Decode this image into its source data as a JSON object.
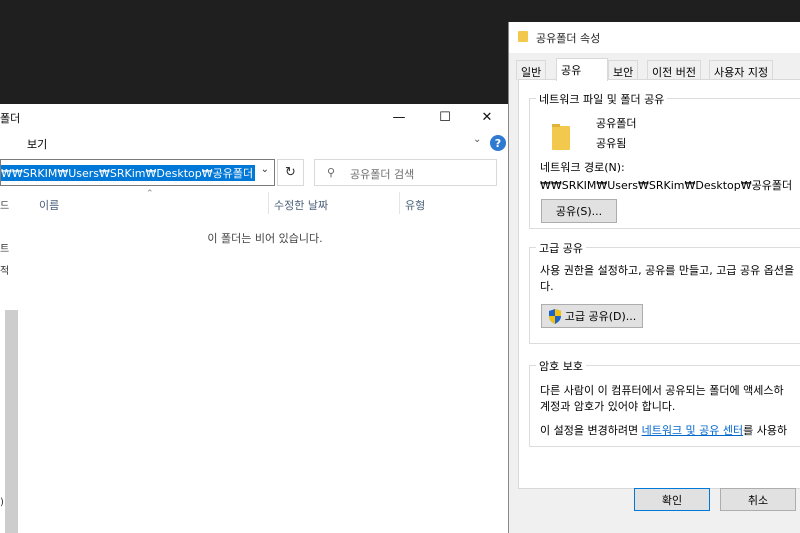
{
  "explorer": {
    "title": "폴더",
    "ribbon_view": "보기",
    "controls": {
      "minimize": "—",
      "maximize": "☐",
      "close": "✕"
    },
    "address": "₩₩SRKIM₩Users₩SRKim₩Desktop₩공유폴더",
    "search_placeholder": "공유폴더 검색",
    "columns": {
      "name": "이름",
      "modified": "수정한 날짜",
      "type": "유형"
    },
    "empty_message": "이 폴더는 비어 있습니다.",
    "nav_fragments": [
      "드",
      "트",
      "적",
      ")"
    ]
  },
  "properties": {
    "title": "공유폴더 속성",
    "tabs": [
      "일반",
      "공유",
      "보안",
      "이전 버전",
      "사용자 지정"
    ],
    "active_tab": "공유",
    "network_share": {
      "group_label": "네트워크 파일 및 폴더 공유",
      "folder_name": "공유폴더",
      "status": "공유됨",
      "path_label": "네트워크 경로(N):",
      "path_value": "₩₩SRKIM₩Users₩SRKim₩Desktop₩공유폴더",
      "share_button": "공유(S)..."
    },
    "advanced_share": {
      "group_label": "고급 공유",
      "description_line1": "사용 권한을 설정하고, 공유를 만들고, 고급 공유 옵션을",
      "description_line2": "다.",
      "button": "고급 공유(D)..."
    },
    "password_protection": {
      "group_label": "암호 보호",
      "line1": "다른 사람이 이 컴퓨터에서 공유되는 폴더에 액세스하",
      "line2": "계정과 암호가 있어야 합니다.",
      "line3_prefix": "이 설정을 변경하려면 ",
      "line3_link": "네트워크 및 공유 센터",
      "line3_suffix": "를 사용하"
    },
    "ok_button": "확인",
    "cancel_button": "취소"
  },
  "colors": {
    "selection": "#0078d7",
    "folder": "#f2c94c",
    "link": "#0066cc",
    "background": "#1f1f1f"
  }
}
